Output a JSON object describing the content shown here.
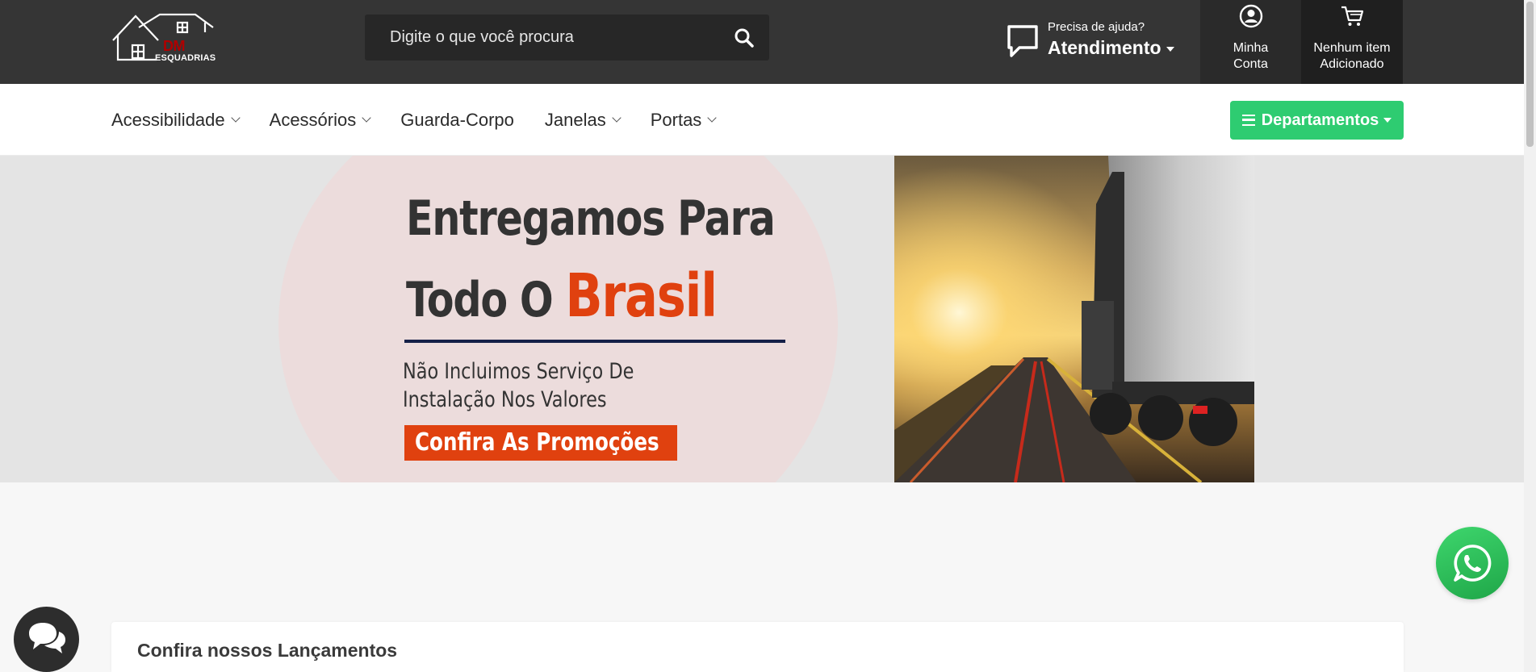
{
  "logo": {
    "name": "DM",
    "tagline": "ESQUADRIAS"
  },
  "search": {
    "placeholder": "Digite o que você procura"
  },
  "help": {
    "small": "Precisa de ajuda?",
    "big": "Atendimento"
  },
  "account": {
    "line1": "Minha",
    "line2": "Conta"
  },
  "cart": {
    "line1": "Nenhum item",
    "line2": "Adicionado"
  },
  "nav": {
    "items": [
      {
        "label": "Acessibilidade",
        "has_dropdown": true
      },
      {
        "label": "Acessórios",
        "has_dropdown": true
      },
      {
        "label": "Guarda-Corpo",
        "has_dropdown": false
      },
      {
        "label": "Janelas",
        "has_dropdown": true
      },
      {
        "label": "Portas",
        "has_dropdown": true
      }
    ],
    "departments_label": "Departamentos"
  },
  "banner": {
    "line1": "Entregamos Para",
    "line2_prefix": "Todo O ",
    "line2_accent": "Brasil",
    "sub1": "Não Incluimos Serviço De",
    "sub2": "Instalação Nos Valores",
    "cta": "Confira As Promoções"
  },
  "launch": {
    "prefix": "Confira nossos ",
    "highlight": "Lançamentos"
  },
  "colors": {
    "topbar": "#353535",
    "accent_green": "#2ecc71",
    "banner_accent": "#e0410f",
    "whatsapp": "#25d366"
  },
  "icons": {
    "search": "search-icon",
    "help": "chat-icon",
    "account": "user-icon",
    "cart": "cart-icon",
    "whatsapp": "whatsapp-icon",
    "chat_widget": "chat-bubbles-icon"
  }
}
